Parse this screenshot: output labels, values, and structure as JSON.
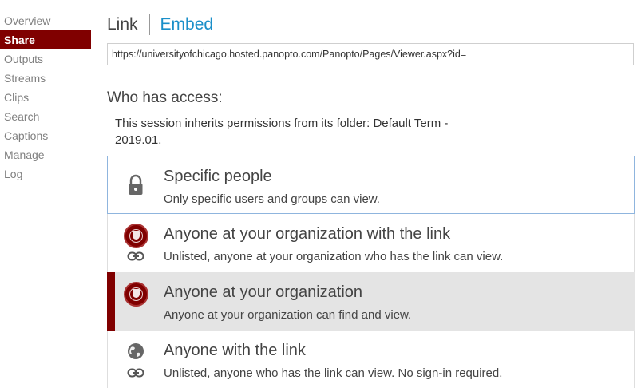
{
  "sidebar": {
    "items": [
      {
        "label": "Overview",
        "active": false
      },
      {
        "label": "Share",
        "active": true
      },
      {
        "label": "Outputs",
        "active": false
      },
      {
        "label": "Streams",
        "active": false
      },
      {
        "label": "Clips",
        "active": false
      },
      {
        "label": "Search",
        "active": false
      },
      {
        "label": "Captions",
        "active": false
      },
      {
        "label": "Manage",
        "active": false
      },
      {
        "label": "Log",
        "active": false
      }
    ]
  },
  "tabs": {
    "link_label": "Link",
    "embed_label": "Embed"
  },
  "url_field": {
    "value": "https://universityofchicago.hosted.panopto.com/Panopto/Pages/Viewer.aspx?id="
  },
  "access": {
    "title": "Who has access:",
    "inherit_text": "This session inherits permissions from its folder: Default Term - 2019.01.",
    "options": [
      {
        "title": "Specific people",
        "description": "Only specific users and groups can view.",
        "icon": "lock-icon",
        "state": "selected"
      },
      {
        "title": "Anyone at your organization with the link",
        "description": "Unlisted, anyone at your organization who has the link can view.",
        "icon": "organization-seal-icon",
        "state": "normal"
      },
      {
        "title": "Anyone at your organization",
        "description": "Anyone at your organization can find and view.",
        "icon": "organization-seal-icon",
        "state": "highlighted"
      },
      {
        "title": "Anyone with the link",
        "description": "Unlisted, anyone who has the link can view. No sign-in required.",
        "icon": "globe-icon",
        "state": "normal"
      }
    ]
  },
  "colors": {
    "brand": "#800000",
    "link_accent": "#1a8fc9",
    "selected_border": "#8fb5de",
    "highlight_bg": "#e4e4e4"
  }
}
